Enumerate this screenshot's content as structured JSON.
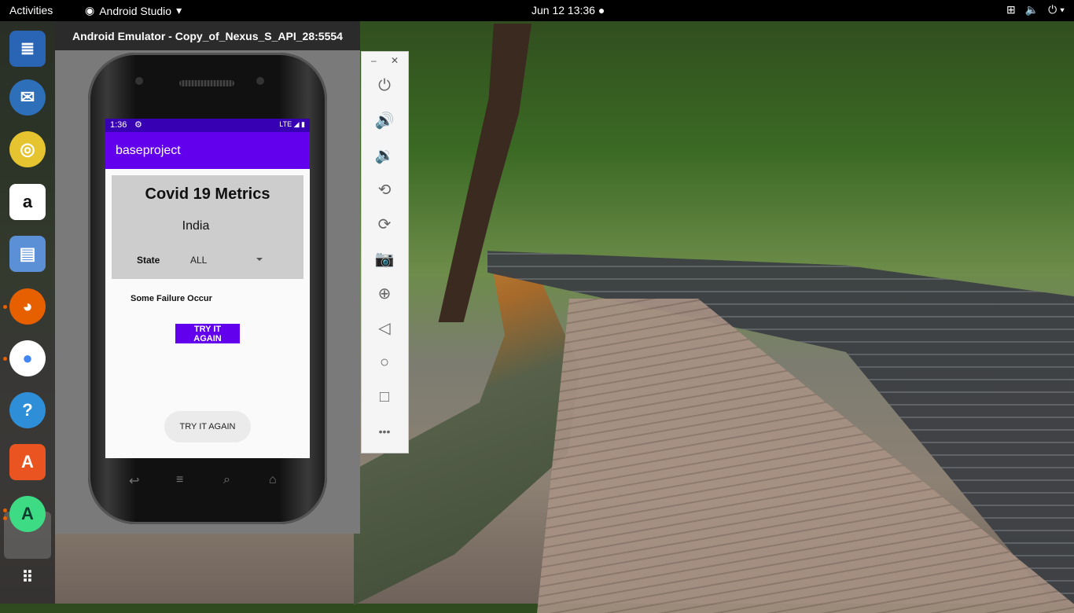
{
  "topbar": {
    "activities": "Activities",
    "app_name": "Android Studio",
    "clock": "Jun 12  13:36 ●"
  },
  "dock": {
    "items": [
      "writer",
      "thunderbird",
      "rhythmbox",
      "amazon",
      "files",
      "firefox",
      "chrome",
      "help",
      "software",
      "android-studio",
      "show-apps"
    ],
    "amazon_glyph": "a",
    "help_glyph": "?"
  },
  "emulator": {
    "title": "Android Emulator - Copy_of_Nexus_S_API_28:5554",
    "status_time": "1:36",
    "status_right": "LTE ◢ ▮",
    "app_title": "baseproject",
    "heading": "Covid 19 Metrics",
    "country": "India",
    "state_label": "State",
    "state_value": "ALL",
    "failure_text": "Some Failure Occur",
    "retry_primary": "TRY  IT AGAIN",
    "retry_secondary": "TRY IT AGAIN"
  },
  "toolbar": {
    "minimize": "–",
    "close": "✕",
    "more": "•••"
  },
  "colors": {
    "status_bar": "#3700b3",
    "app_bar": "#6200ee",
    "card": "#cdcdcd"
  }
}
